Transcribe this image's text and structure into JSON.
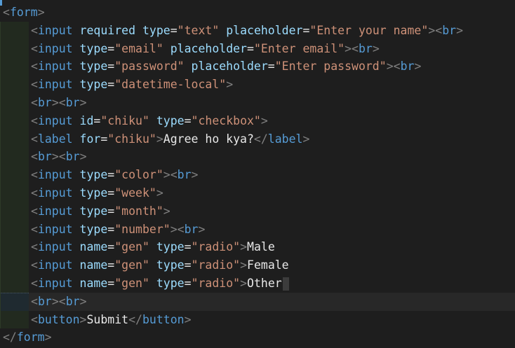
{
  "editor": {
    "colors": {
      "background": "#1e1e1e",
      "tag": "#569cd6",
      "attribute": "#9cdcfe",
      "string": "#ce9178",
      "text": "#e8e8e8",
      "punctuation": "#808080"
    },
    "lines": [
      {
        "kind": "open_form",
        "tag": "form"
      },
      {
        "kind": "input",
        "tokens": [
          [
            "t",
            "input"
          ],
          [
            "a",
            "required"
          ],
          [
            "a",
            "type"
          ],
          [
            "s",
            "\"text\""
          ],
          [
            "a",
            "placeholder"
          ],
          [
            "s",
            "\"Enter your name\""
          ],
          [
            "br",
            "br"
          ]
        ]
      },
      {
        "kind": "input",
        "tokens": [
          [
            "t",
            "input"
          ],
          [
            "a",
            "type"
          ],
          [
            "s",
            "\"email\""
          ],
          [
            "a",
            "placeholder"
          ],
          [
            "s",
            "\"Enter email\""
          ],
          [
            "br",
            "br"
          ]
        ]
      },
      {
        "kind": "input",
        "tokens": [
          [
            "t",
            "input"
          ],
          [
            "a",
            "type"
          ],
          [
            "s",
            "\"password\""
          ],
          [
            "a",
            "placeholder"
          ],
          [
            "s",
            "\"Enter password\""
          ],
          [
            "br",
            "br"
          ]
        ]
      },
      {
        "kind": "input",
        "tokens": [
          [
            "t",
            "input"
          ],
          [
            "a",
            "type"
          ],
          [
            "s",
            "\"datetime-local\""
          ]
        ]
      },
      {
        "kind": "br2"
      },
      {
        "kind": "input",
        "tokens": [
          [
            "t",
            "input"
          ],
          [
            "a",
            "id"
          ],
          [
            "s",
            "\"chiku\""
          ],
          [
            "a",
            "type"
          ],
          [
            "s",
            "\"checkbox\""
          ]
        ]
      },
      {
        "kind": "label",
        "attr": "for",
        "value": "\"chiku\"",
        "text": "Agree ho kya?"
      },
      {
        "kind": "br2"
      },
      {
        "kind": "input",
        "tokens": [
          [
            "t",
            "input"
          ],
          [
            "a",
            "type"
          ],
          [
            "s",
            "\"color\""
          ],
          [
            "br",
            "br"
          ]
        ]
      },
      {
        "kind": "input",
        "tokens": [
          [
            "t",
            "input"
          ],
          [
            "a",
            "type"
          ],
          [
            "s",
            "\"week\""
          ]
        ]
      },
      {
        "kind": "input",
        "tokens": [
          [
            "t",
            "input"
          ],
          [
            "a",
            "type"
          ],
          [
            "s",
            "\"month\""
          ]
        ]
      },
      {
        "kind": "input",
        "tokens": [
          [
            "t",
            "input"
          ],
          [
            "a",
            "type"
          ],
          [
            "s",
            "\"number\""
          ],
          [
            "br",
            "br"
          ]
        ]
      },
      {
        "kind": "radio",
        "name": "\"gen\"",
        "type": "\"radio\"",
        "text": "Male"
      },
      {
        "kind": "radio",
        "name": "\"gen\"",
        "type": "\"radio\"",
        "text": "Female"
      },
      {
        "kind": "radio",
        "name": "\"gen\"",
        "type": "\"radio\"",
        "text": "Other",
        "cursor": true
      },
      {
        "kind": "br2",
        "active": true
      },
      {
        "kind": "button",
        "text": "Submit"
      },
      {
        "kind": "close_form",
        "tag": "form"
      }
    ]
  },
  "labels": {
    "lt": "<",
    "gt": ">",
    "lt_slash": "</",
    "eq": "=",
    "br": "br",
    "label": "label",
    "button": "button",
    "input": "input",
    "name": "name",
    "type": "type"
  }
}
